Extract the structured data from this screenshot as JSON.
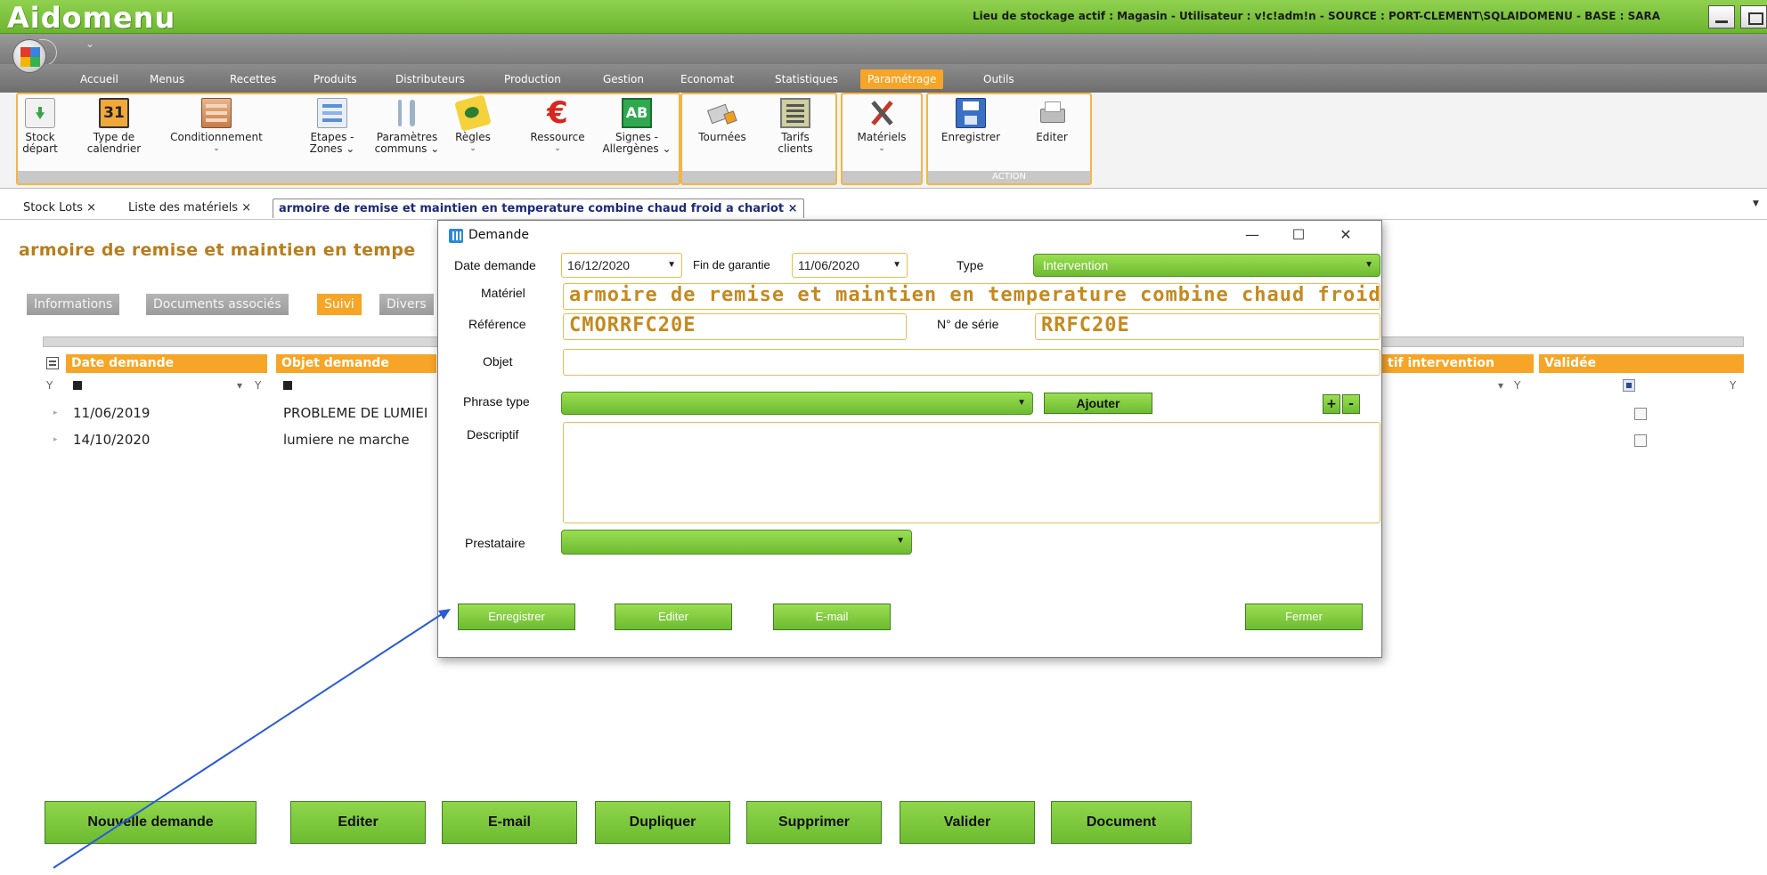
{
  "app": {
    "name": "Aidomenu",
    "status": "Lieu de stockage actif : Magasin - Utilisateur : v!c!adm!n - SOURCE : PORT-CLEMENT\\SQLAIDOMENU - BASE : SARA"
  },
  "menu": {
    "tabs": [
      "Accueil",
      "Menus",
      "Recettes",
      "Produits",
      "Distributeurs",
      "Production",
      "Gestion",
      "Economat",
      "Statistiques",
      "Paramétrage",
      "Outils"
    ],
    "active": "Paramétrage"
  },
  "ribbon": {
    "stock": "Stock départ",
    "stock_l1": "Stock",
    "stock_l2": "départ",
    "type_cal_l1": "Type de",
    "type_cal_l2": "calendrier",
    "cal_day": "31",
    "conditionnement": "Conditionnement",
    "etapes_l1": "Etapes -",
    "etapes_l2": "Zones",
    "params_l1": "Paramètres",
    "params_l2": "communs",
    "regles": "Règles",
    "ressource": "Ressource",
    "signes_l1": "Signes -",
    "signes_l2": "Allergènes",
    "signes_icon_text": "AB",
    "tournees": "Tournées",
    "tarifs_l1": "Tarifs",
    "tarifs_l2": "clients",
    "materiels": "Matériels",
    "enregistrer": "Enregistrer",
    "editer": "Editer",
    "action_group": "ACTION",
    "chevron": "⌄"
  },
  "doc_tabs": {
    "tab1": "Stock Lots",
    "tab2": "Liste des matériels",
    "tab3": "armoire de remise et maintien en temperature combine chaud froid  a chariot",
    "close": "×",
    "dropdown": "▼"
  },
  "page": {
    "title": "armoire de remise et maintien en tempe",
    "subtabs": [
      "Informations",
      "Documents associés",
      "Suivi",
      "Divers"
    ],
    "active_subtab": "Suivi"
  },
  "grid": {
    "columns": {
      "date_demande": "Date demande",
      "objet_demande": "Objet demande",
      "motif_intervention": "tif intervention",
      "validee": "Validée"
    },
    "rows": [
      {
        "date": "11/06/2019",
        "objet": "PROBLEME DE LUMIEI"
      },
      {
        "date": "14/10/2020",
        "objet": "lumiere ne marche"
      }
    ],
    "filter_caret": "▾",
    "filter_icon": "Y"
  },
  "bottom_buttons": {
    "nouvelle_demande": "Nouvelle demande",
    "editer": "Editer",
    "email": "E-mail",
    "dupliquer": "Dupliquer",
    "supprimer": "Supprimer",
    "valider": "Valider",
    "document": "Document"
  },
  "dialog": {
    "title": "Demande",
    "ctrl_min": "—",
    "ctrl_max": "☐",
    "ctrl_close": "✕",
    "date_demande_label": "Date demande",
    "date_demande": "16/12/2020",
    "fin_garantie_label": "Fin de garantie",
    "fin_garantie": "11/06/2020",
    "type_label": "Type",
    "type_value": "Intervention",
    "materiel_label": "Matériel",
    "materiel_value": "armoire de remise et maintien en temperature combine chaud froid  a chario",
    "reference_label": "Référence",
    "reference_value": "CMORRFC20E",
    "serie_label": "N° de série",
    "serie_value": "RRFC20E",
    "objet_label": "Objet",
    "objet_value": "",
    "phrase_label": "Phrase type",
    "ajouter": "Ajouter",
    "plus": "+",
    "minus": "-",
    "descriptif_label": "Descriptif",
    "prestataire_label": "Prestataire",
    "enregistrer": "Enregistrer",
    "editer": "Editer",
    "email": "E-mail",
    "fermer": "Fermer"
  },
  "colors": {
    "accent_orange": "#f7a526",
    "brand_green": "#6dbb31",
    "title_gold": "#b87e1c"
  }
}
